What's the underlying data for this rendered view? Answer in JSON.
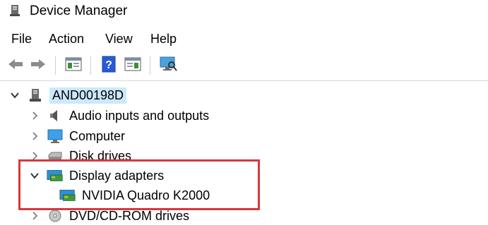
{
  "window": {
    "title": "Device Manager",
    "icon": "device-manager-icon"
  },
  "menu": [
    "File",
    "Action",
    "View",
    "Help"
  ],
  "toolbar": [
    {
      "icon": "back-arrow-icon"
    },
    {
      "icon": "forward-arrow-icon"
    },
    {
      "icon": "show-hide-console-tree-icon"
    },
    {
      "icon": "help-icon"
    },
    {
      "icon": "properties-icon"
    },
    {
      "icon": "scan-hardware-changes-icon"
    }
  ],
  "tree": {
    "root": {
      "label": "AND00198D",
      "expanded": true,
      "selected": true,
      "icon": "computer-tower-icon"
    },
    "items": [
      {
        "label": "Audio inputs and outputs",
        "expanded": false,
        "icon": "speaker-icon"
      },
      {
        "label": "Computer",
        "expanded": false,
        "icon": "monitor-icon"
      },
      {
        "label": "Disk drives",
        "expanded": false,
        "icon": "disk-drive-icon"
      },
      {
        "label": "Display adapters",
        "expanded": true,
        "icon": "display-adapter-icon",
        "children": [
          {
            "label": "NVIDIA Quadro K2000",
            "icon": "display-adapter-icon"
          }
        ]
      },
      {
        "label": "DVD/CD-ROM drives",
        "expanded": false,
        "icon": "dvd-drive-icon"
      }
    ]
  },
  "colors": {
    "selection": "#cce8ff",
    "highlight_border": "#d9373c"
  }
}
